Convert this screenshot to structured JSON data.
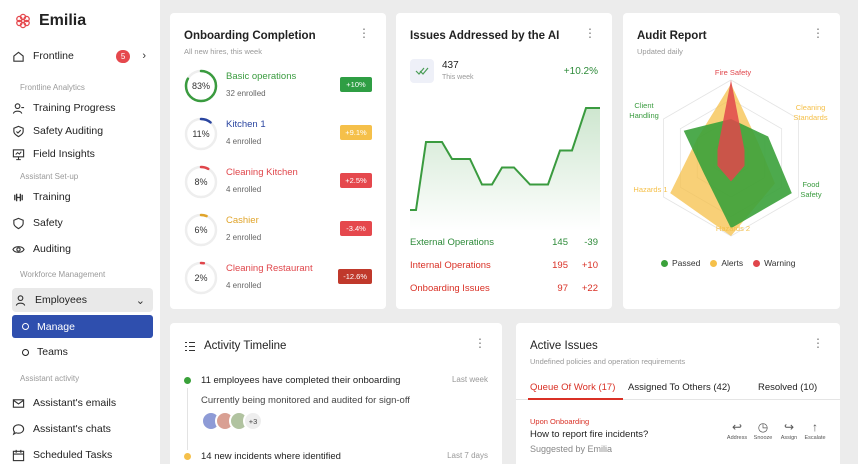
{
  "brand": {
    "name": "Emilia"
  },
  "sidebar": {
    "frontline": {
      "label": "Frontline",
      "badge": "5"
    },
    "sections": {
      "analytics": "Frontline Analytics",
      "assistant_setup": "Assistant Set-up",
      "workforce": "Workforce Management",
      "activity": "Assistant activity"
    },
    "analytics_items": [
      {
        "label": "Training Progress"
      },
      {
        "label": "Safety Auditing"
      },
      {
        "label": "Field Insights"
      }
    ],
    "setup_items": [
      {
        "label": "Training"
      },
      {
        "label": "Safety"
      },
      {
        "label": "Auditing"
      }
    ],
    "employees": {
      "label": "Employees",
      "sub": [
        {
          "label": "Manage"
        },
        {
          "label": "Teams"
        }
      ]
    },
    "activity_items": [
      {
        "label": "Assistant's emails"
      },
      {
        "label": "Assistant's chats"
      },
      {
        "label": "Scheduled Tasks"
      }
    ]
  },
  "onboarding": {
    "title": "Onboarding Completion",
    "subtitle": "All new hires, this week",
    "rows": [
      {
        "pct_label": "83%",
        "pct": 0.83,
        "name": "Basic operations",
        "enrolled": "32 enrolled",
        "change": "+10%",
        "color": "#3a9b3f",
        "chip": "#2f9e44"
      },
      {
        "pct_label": "11%",
        "pct": 0.11,
        "name": "Kitchen 1",
        "enrolled": "4 enrolled",
        "change": "+9.1%",
        "color": "#2a45a0",
        "chip": "#f5c04a"
      },
      {
        "pct_label": "8%",
        "pct": 0.08,
        "name": "Cleaning Kitchen",
        "enrolled": "4 enrolled",
        "change": "+2.5%",
        "color": "#e0464b",
        "chip": "#e5484d"
      },
      {
        "pct_label": "6%",
        "pct": 0.06,
        "name": "Cashier",
        "enrolled": "2 enrolled",
        "change": "-3.4%",
        "color": "#e0a42a",
        "chip": "#e5484d"
      },
      {
        "pct_label": "2%",
        "pct": 0.02,
        "name": "Cleaning Restaurant",
        "enrolled": "4 enrolled",
        "change": "-12.6%",
        "color": "#e0464b",
        "chip": "#c0392b"
      }
    ]
  },
  "issues": {
    "title": "Issues Addressed by the AI",
    "count": "437",
    "period": "This week",
    "change": "+10.2%",
    "chart_data": {
      "type": "area",
      "values": [
        2,
        2,
        10,
        10,
        8,
        8,
        5,
        5,
        7,
        7,
        5,
        5,
        9,
        9,
        14,
        14
      ]
    },
    "lines": [
      {
        "label": "External Operations",
        "v1": "145",
        "v2": "-39",
        "color": "#2e8b3a"
      },
      {
        "label": "Internal Operations",
        "v1": "195",
        "v2": "+10",
        "color": "#d93025"
      },
      {
        "label": "Onboarding Issues",
        "v1": "97",
        "v2": "+22",
        "color": "#d93025"
      }
    ]
  },
  "audit": {
    "title": "Audit Report",
    "subtitle": "Updated daily",
    "axes": [
      "Fire Safety",
      "Cleaning Standards",
      "Food Safety",
      "Hazards 2",
      "Hazards 1",
      "Client Handling"
    ],
    "chart_data": {
      "type": "radar",
      "series": [
        {
          "name": "Passed",
          "values": [
            0.5,
            0.55,
            0.9,
            0.9,
            0.4,
            0.7
          ]
        },
        {
          "name": "Alerts",
          "values": [
            0.95,
            0.4,
            0.65,
            1.0,
            0.9,
            0.5
          ]
        },
        {
          "name": "Warning",
          "values": [
            1.0,
            0.2,
            0.2,
            0.3,
            0.2,
            0.2
          ]
        }
      ]
    },
    "legend": [
      {
        "label": "Passed",
        "color": "#3aa13a"
      },
      {
        "label": "Alerts",
        "color": "#f5c04a"
      },
      {
        "label": "Warning",
        "color": "#e0464b"
      }
    ]
  },
  "activity": {
    "title": "Activity Timeline",
    "items": [
      {
        "text": "11 employees have completed their onboarding",
        "when": "Last week",
        "color": "#3aa13a"
      },
      {
        "text": "14 new incidents where identified",
        "when": "Last 7 days",
        "color": "#f5c04a"
      }
    ],
    "note": "Currently being monitored and audited for sign-off",
    "more": "+3"
  },
  "active_issues": {
    "title": "Active Issues",
    "subtitle": "Undefined policies and operation requirements",
    "tabs": [
      "Queue Of Work (17)",
      "Assigned To Others (42)",
      "Resolved (10)"
    ],
    "item": {
      "category": "Upon Onboarding",
      "question": "How to report fire incidents?",
      "suggested": "Suggested by Emilia"
    },
    "actions": [
      {
        "glyph": "↩",
        "label": "Address"
      },
      {
        "glyph": "◷",
        "label": "Snooze"
      },
      {
        "glyph": "↪",
        "label": "Assign"
      },
      {
        "glyph": "↑",
        "label": "Escalate"
      }
    ]
  }
}
